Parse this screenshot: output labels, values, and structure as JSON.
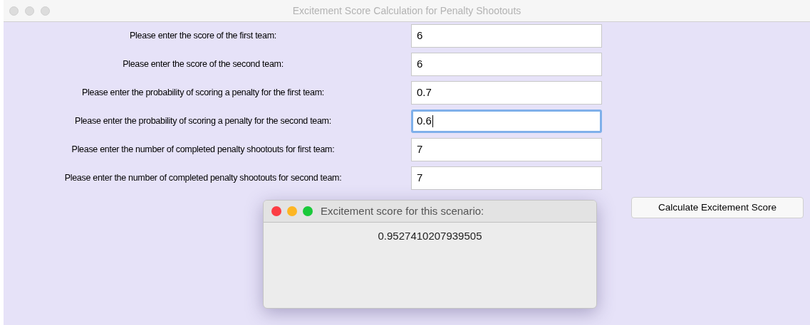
{
  "window": {
    "title": "Excitement Score Calculation for Penalty Shootouts"
  },
  "fields": [
    {
      "label": "Please enter the score of the first team:",
      "value": "6",
      "focused": false
    },
    {
      "label": "Please enter the score of the second team:",
      "value": "6",
      "focused": false
    },
    {
      "label": "Please enter the probability of scoring a penalty for the first team:",
      "value": "0.7",
      "focused": false
    },
    {
      "label": "Please enter the probability of scoring a penalty for the second team:",
      "value": "0.6",
      "focused": true
    },
    {
      "label": "Please enter the number of completed penalty shootouts for first team:",
      "value": "7",
      "focused": false
    },
    {
      "label": "Please enter the number of completed penalty shootouts for second team:",
      "value": "7",
      "focused": false
    }
  ],
  "button": "Calculate Excitement Score",
  "dialog": {
    "title": "Excitement score for this scenario:",
    "message": "0.9527410207939505"
  }
}
